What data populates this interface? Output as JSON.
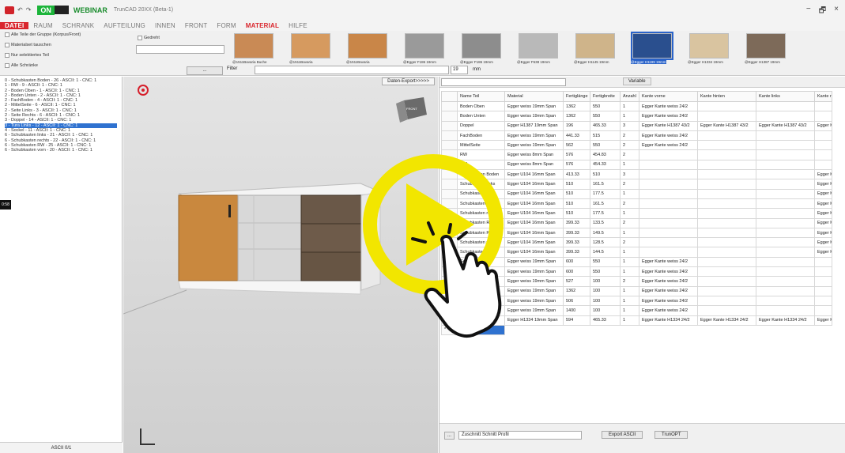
{
  "titlebar": {
    "on_label": "ON",
    "webinar": "WEBINAR",
    "app_title": "TrunCAD 20XX (Beta-1)",
    "win_min": "−",
    "win_max": "🗗",
    "win_close": "×"
  },
  "menu": [
    "DATEI",
    "RAUM",
    "SCHRANK",
    "AUFTEILUNG",
    "INNEN",
    "FRONT",
    "FORM",
    "MATERIAL",
    "HILFE"
  ],
  "active_menu": "MATERIAL",
  "ribbon": {
    "checks": [
      "Alle Teile der Gruppe (Korpus/Front)",
      "Materialset tauschen",
      "Nur selektiertes Teil",
      "Alle Schränke"
    ],
    "gedreht": "Gedreht",
    "dots_btn": "...",
    "filter_label": "Filter",
    "thickness": "19",
    "unit": "mm",
    "swatches": [
      {
        "label": "@1511Bavaria Buche",
        "color": "#c98a55"
      },
      {
        "label": "@1511Bavaria",
        "color": "#d69a5f"
      },
      {
        "label": "@1511Bavaria",
        "color": "#c98648"
      },
      {
        "label": "@Egger F186 19mm",
        "color": "#9a9a9a"
      },
      {
        "label": "@Egger F186 19mm",
        "color": "#8d8d8d"
      },
      {
        "label": "@Egger F638 19mm",
        "color": "#b9b9b9"
      },
      {
        "label": "@Egger H1145 19mm",
        "color": "#cfb48a"
      },
      {
        "label": "@Egger H1199 19mm",
        "color": "#2a4f8e"
      },
      {
        "label": "@Egger H1334 19mm",
        "color": "#d9c4a0"
      },
      {
        "label": "@Egger H1387 19mm",
        "color": "#7d6a59"
      }
    ]
  },
  "tree": [
    "0 - Schubkasten Boden - 26 - ASCII: 1 - CNC: 1",
    "1 - RW - 9 - ASCII: 1 - CNC: 1",
    "2 - Boden Oben - 1 - ASCII: 1 - CNC: 1",
    "2 - Boden Unten - 2 - ASCII: 1 - CNC: 1",
    "2 - FachBoden - 4 - ASCII: 1 - CNC: 1",
    "2 - MittelSeite - 6 - ASCII: 1 - CNC: 1",
    "2 - Seite Links - 3 - ASCII: 1 - CNC: 1",
    "2 - Seite Rechts - 6 - ASCII: 1 - CNC: 1",
    "3 - Doppel - 14 - ASCII: 1 - CNC: 1",
    "3 - Tura Links - 12 - ASCII: 1 - CNC: 1",
    "4 - Sockel - 11 - ASCII: 1 - CNC: 1",
    "6 - Schubkasten links - 21 - ASCII: 1 - CNC: 1",
    "6 - Schubkasten rechts - 22 - ASCII: 1 - CNC: 1",
    "6 - Schubkasten RW - 25 - ASCII: 1 - CNC: 1",
    "6 - Schubkasten vorn - 20 - ASCII: 1 - CNC: 1"
  ],
  "tree_selected_index": 9,
  "left_footer": "ASCII 0/1",
  "viewport": {
    "export_btn": "Daten-Export>>>>>",
    "cube_label": "FRONT",
    "side_tag": "0:58"
  },
  "table": {
    "variable_btn": "Variable",
    "headers": [
      "Name Teil",
      "Material",
      "Fertiglänge",
      "Fertigbreite",
      "Anzahl",
      "Kante vorne",
      "Kante hinten",
      "Kante links",
      "Kante r"
    ],
    "rows": [
      [
        "Boden Oben",
        "Egger weiss 19mm Span",
        "1362",
        "550",
        "1",
        "Egger Kante weiss 24/2",
        "",
        "",
        ""
      ],
      [
        "Boden Unten",
        "Egger weiss 19mm Span",
        "1362",
        "550",
        "1",
        "Egger Kante weiss 24/2",
        "",
        "",
        ""
      ],
      [
        "Doppel",
        "Egger H1387 19mm Span",
        "196",
        "465.33",
        "3",
        "Egger Kante H1387 43/2",
        "Egger Kante H1387 43/2",
        "Egger Kante H1387 43/2",
        "Egger K"
      ],
      [
        "FachBoden",
        "Egger weiss 19mm Span",
        "441.33",
        "515",
        "2",
        "Egger Kante weiss 24/2",
        "",
        "",
        ""
      ],
      [
        "MittelSeite",
        "Egger weiss 19mm Span",
        "562",
        "550",
        "2",
        "Egger Kante weiss 24/2",
        "",
        "",
        ""
      ],
      [
        "RW",
        "Egger weiss 8mm Span",
        "576",
        "454.83",
        "2",
        "",
        "",
        "",
        ""
      ],
      [
        "RW",
        "Egger weiss 8mm Span",
        "576",
        "454.33",
        "1",
        "",
        "",
        "",
        ""
      ],
      [
        "Schubkasten Boden",
        "Egger U104 16mm Span",
        "413.33",
        "510",
        "3",
        "",
        "",
        "",
        "Egger K"
      ],
      [
        "Schubkasten links",
        "Egger U104 16mm Span",
        "510",
        "161.5",
        "2",
        "",
        "",
        "",
        "Egger K"
      ],
      [
        "Schubkasten links",
        "Egger U104 16mm Span",
        "510",
        "177.5",
        "1",
        "",
        "",
        "",
        "Egger K"
      ],
      [
        "Schubkasten rechts",
        "Egger U104 16mm Span",
        "510",
        "161.5",
        "2",
        "",
        "",
        "",
        "Egger K"
      ],
      [
        "Schubkasten rechts",
        "Egger U104 16mm Span",
        "510",
        "177.5",
        "1",
        "",
        "",
        "",
        "Egger K"
      ],
      [
        "Schubkasten RW",
        "Egger U104 16mm Span",
        "399.33",
        "133.5",
        "2",
        "",
        "",
        "",
        "Egger K"
      ],
      [
        "Schubkasten RW",
        "Egger U104 16mm Span",
        "399.33",
        "149.5",
        "1",
        "",
        "",
        "",
        "Egger K"
      ],
      [
        "Schubkasten vorn",
        "Egger U104 16mm Span",
        "399.33",
        "128.5",
        "2",
        "",
        "",
        "",
        "Egger K"
      ],
      [
        "Schubkasten vorn",
        "Egger U104 16mm Span",
        "399.33",
        "144.5",
        "1",
        "",
        "",
        "",
        "Egger K"
      ],
      [
        "Seite Links",
        "Egger weiss 19mm Span",
        "600",
        "550",
        "1",
        "Egger Kante weiss 24/2",
        "",
        "",
        ""
      ],
      [
        "Seite Rechts",
        "Egger weiss 19mm Span",
        "600",
        "550",
        "1",
        "Egger Kante weiss 24/2",
        "",
        "",
        ""
      ],
      [
        "Sockel",
        "Egger weiss 19mm Span",
        "527",
        "100",
        "2",
        "Egger Kante weiss 24/2",
        "",
        "",
        ""
      ],
      [
        "Sockel",
        "Egger weiss 19mm Span",
        "1362",
        "100",
        "1",
        "Egger Kante weiss 24/2",
        "",
        "",
        ""
      ],
      [
        "Sockel",
        "Egger weiss 19mm Span",
        "506",
        "100",
        "1",
        "Egger Kante weiss 24/2",
        "",
        "",
        ""
      ],
      [
        "Sockel",
        "Egger weiss 19mm Span",
        "1400",
        "100",
        "1",
        "Egger Kante weiss 24/2",
        "",
        "",
        ""
      ],
      [
        "Tura Links",
        "Egger H1334 19mm Span",
        "594",
        "465.33",
        "1",
        "Egger Kante H1334 24/2",
        "Egger Kante H1334 24/2",
        "Egger Kante H1334 24/2",
        "Egger K"
      ]
    ],
    "new_row_marker": "*",
    "footer": {
      "dots": "...",
      "combo": "Zuschnitt Schnitt Profil",
      "export_ascii": "Export ASCII",
      "trunopt": "TrunOPT"
    }
  },
  "overlay": {
    "name": "play-button-overlay",
    "color": "#f2e600"
  }
}
